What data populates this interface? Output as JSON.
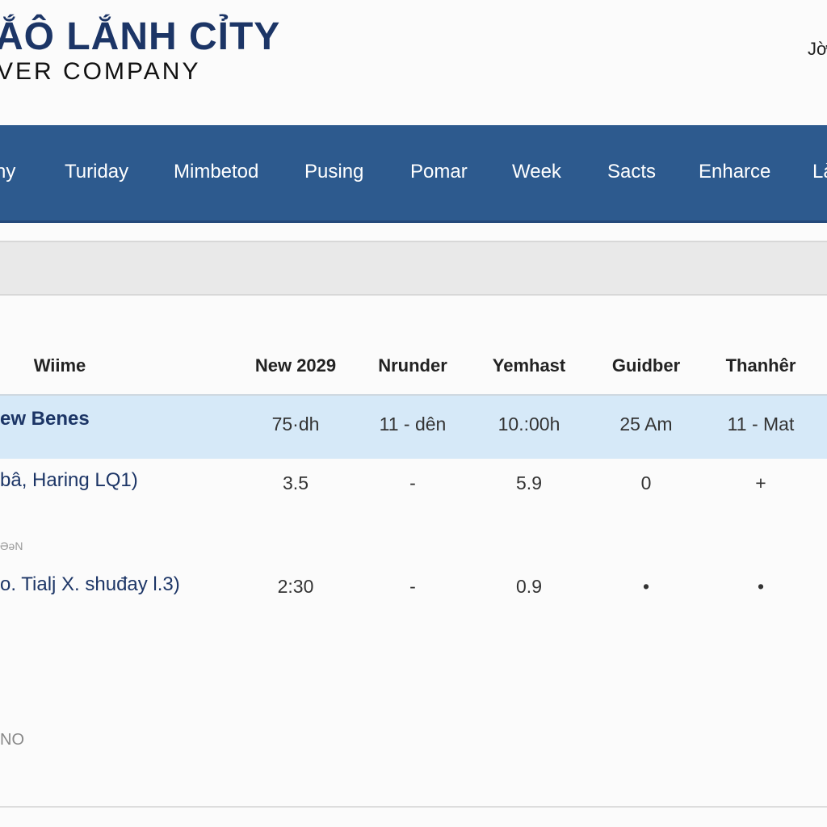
{
  "header": {
    "logo_title": "ẮÔ LẮNH CỈTY",
    "logo_subtitle": "VER COMPANY",
    "user": "Jờ"
  },
  "nav": [
    "ny",
    "Turiday",
    "Mimbetod",
    "Pusing",
    "Pomar",
    "Week",
    "Sacts",
    "Enharce",
    "Là"
  ],
  "table": {
    "headers": [
      "Wiime",
      "New 2029",
      "Nrunder",
      "Yemhast",
      "Guidber",
      "Thanhêr"
    ],
    "rows": [
      {
        "name": "ew Benes",
        "cells": [
          "75·dh",
          "11 - dên",
          "10.:00h",
          "25 Am",
          "11 - Mat"
        ]
      },
      {
        "name": "bâ, Haring LQ1)",
        "cells": [
          "3.5",
          "-",
          "5.9",
          "0",
          "+"
        ]
      },
      {
        "name": "o. Tialj X. shuđay l.3)",
        "cells": [
          "2:30",
          "-",
          "0.9",
          "•",
          "•"
        ]
      }
    ],
    "note": "ƏəN"
  },
  "footer_label": "NO"
}
